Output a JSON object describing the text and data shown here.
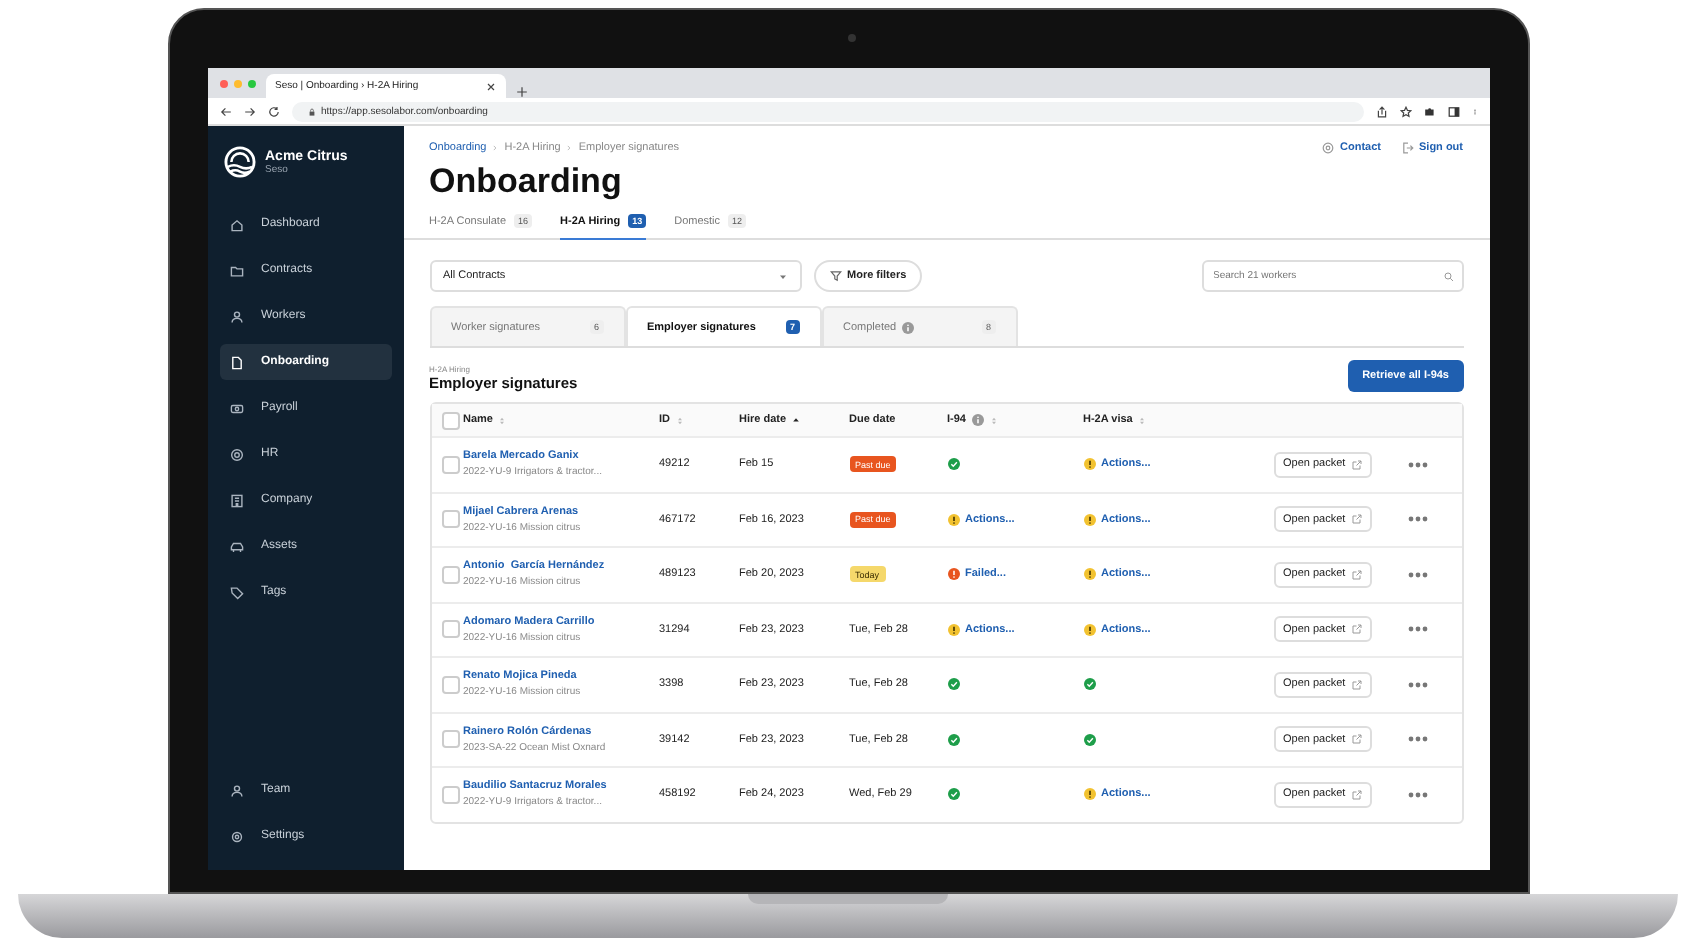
{
  "browser": {
    "tab_title": "Seso | Onboarding › H-2A Hiring",
    "url": "https://app.sesolabor.com/onboarding"
  },
  "sidebar": {
    "org": "Acme Citrus",
    "org_sub": "Seso",
    "items": [
      {
        "label": "Dashboard",
        "selected": false
      },
      {
        "label": "Contracts",
        "selected": false
      },
      {
        "label": "Workers",
        "selected": false
      },
      {
        "label": "Onboarding",
        "selected": true
      },
      {
        "label": "Payroll",
        "selected": false
      },
      {
        "label": "HR",
        "selected": false
      },
      {
        "label": "Company",
        "selected": false
      },
      {
        "label": "Assets",
        "selected": false
      },
      {
        "label": "Tags",
        "selected": false
      }
    ],
    "bottom_items": [
      {
        "label": "Team",
        "selected": false
      },
      {
        "label": "Settings",
        "selected": false
      }
    ]
  },
  "header": {
    "breadcrumb": [
      "Onboarding",
      "H-2A Hiring",
      "Employer signatures"
    ],
    "contact": "Contact",
    "sign_out": "Sign out",
    "title": "Onboarding"
  },
  "tabs": [
    {
      "label": "H-2A Consulate",
      "count": "16",
      "selected": false
    },
    {
      "label": "H-2A Hiring",
      "count": "13",
      "selected": true
    },
    {
      "label": "Domestic",
      "count": "12",
      "selected": false
    }
  ],
  "filters": {
    "contract_select": "All Contracts",
    "more_filters": "More filters",
    "search": {
      "placeholder": "Search 21 workers"
    }
  },
  "subtabs": [
    {
      "label": "Worker signatures",
      "count": "6",
      "selected": false,
      "info": false
    },
    {
      "label": "Employer signatures",
      "count": "7",
      "selected": true,
      "info": false
    },
    {
      "label": "Completed",
      "count": "8",
      "selected": false,
      "info": true
    }
  ],
  "section": {
    "overline": "H-2A Hiring",
    "title": "Employer signatures",
    "action": "Retrieve all I-94s"
  },
  "table": {
    "select_all_checked": false,
    "columns": [
      {
        "label": "Name",
        "sortable": true,
        "sorted": false,
        "info": false
      },
      {
        "label": "ID",
        "sortable": true,
        "sorted": false,
        "info": false
      },
      {
        "label": "Hire date",
        "sortable": true,
        "sorted": true,
        "info": false
      },
      {
        "label": "Due date",
        "sortable": false,
        "sorted": false,
        "info": false
      },
      {
        "label": "I-94",
        "sortable": true,
        "sorted": false,
        "info": true
      },
      {
        "label": "H-2A visa",
        "sortable": true,
        "sorted": false,
        "info": false
      }
    ],
    "rows": [
      {
        "checked": false,
        "name": "Barela Mercado Ganix",
        "contract": "2022-YU-9 Irrigators & tractor...",
        "id": "49212",
        "hire_date": "Feb 15",
        "due": {
          "kind": "past",
          "text": "Past due"
        },
        "i94": {
          "kind": "ok"
        },
        "visa": {
          "kind": "warn",
          "text": "Actions..."
        },
        "open": "Open packet"
      },
      {
        "checked": false,
        "name": "Mijael Cabrera Arenas",
        "contract": "2022-YU-16 Mission citrus",
        "id": "467172",
        "hire_date": "Feb 16, 2023",
        "due": {
          "kind": "past",
          "text": "Past due"
        },
        "i94": {
          "kind": "warn",
          "text": "Actions..."
        },
        "visa": {
          "kind": "warn",
          "text": "Actions..."
        },
        "open": "Open packet"
      },
      {
        "checked": false,
        "name": "Antonio  García Hernández",
        "contract": "2022-YU-16 Mission citrus",
        "id": "489123",
        "hire_date": "Feb 20, 2023",
        "due": {
          "kind": "today",
          "text": "Today"
        },
        "i94": {
          "kind": "fail",
          "text": "Failed..."
        },
        "visa": {
          "kind": "warn",
          "text": "Actions..."
        },
        "open": "Open packet"
      },
      {
        "checked": false,
        "name": "Adomaro Madera Carrillo",
        "contract": "2022-YU-16 Mission citrus",
        "id": "31294",
        "hire_date": "Feb 23, 2023",
        "due": {
          "kind": "plain",
          "text": "Tue, Feb 28"
        },
        "i94": {
          "kind": "warn",
          "text": "Actions..."
        },
        "visa": {
          "kind": "warn",
          "text": "Actions..."
        },
        "open": "Open packet"
      },
      {
        "checked": false,
        "name": "Renato Mojica Pineda",
        "contract": "2022-YU-16 Mission citrus",
        "id": "3398",
        "hire_date": "Feb 23, 2023",
        "due": {
          "kind": "plain",
          "text": "Tue, Feb 28"
        },
        "i94": {
          "kind": "ok"
        },
        "visa": {
          "kind": "ok"
        },
        "open": "Open packet"
      },
      {
        "checked": false,
        "name": "Rainero Rolón Cárdenas",
        "contract": "2023-SA-22 Ocean Mist Oxnard",
        "id": "39142",
        "hire_date": "Feb 23, 2023",
        "due": {
          "kind": "plain",
          "text": "Tue, Feb 28"
        },
        "i94": {
          "kind": "ok"
        },
        "visa": {
          "kind": "ok"
        },
        "open": "Open packet"
      },
      {
        "checked": false,
        "name": "Baudilio Santacruz Morales",
        "contract": "2022-YU-9 Irrigators & tractor...",
        "id": "458192",
        "hire_date": "Feb 24, 2023",
        "due": {
          "kind": "plain",
          "text": "Wed, Feb 29"
        },
        "i94": {
          "kind": "ok"
        },
        "visa": {
          "kind": "warn",
          "text": "Actions..."
        },
        "open": "Open packet"
      }
    ]
  }
}
